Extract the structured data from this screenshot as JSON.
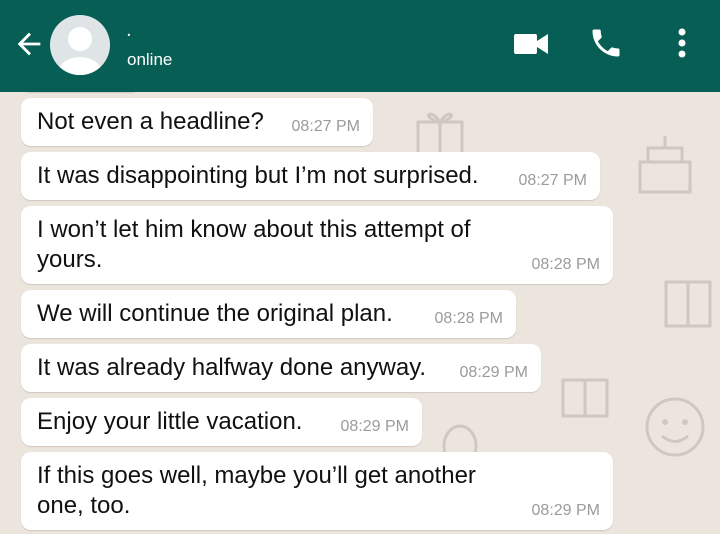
{
  "header": {
    "contact_name": ".",
    "status": "online",
    "icons": [
      "back-arrow-icon",
      "avatar",
      "video-call-icon",
      "voice-call-icon",
      "more-options-icon"
    ],
    "color": "#075e54"
  },
  "messages": [
    {
      "lines": [
        "Not even a headline?"
      ],
      "time": "08:27 PM"
    },
    {
      "lines": [
        "It was disappointing but I’m not surprised."
      ],
      "time": "08:27 PM"
    },
    {
      "lines": [
        "I won’t let him know about this attempt of",
        "yours."
      ],
      "time": "08:28 PM"
    },
    {
      "lines": [
        "We will continue the original plan."
      ],
      "time": "08:28 PM"
    },
    {
      "lines": [
        "It was already halfway done anyway."
      ],
      "time": "08:29 PM"
    },
    {
      "lines": [
        "Enjoy your little vacation."
      ],
      "time": "08:29 PM"
    },
    {
      "lines": [
        "If this goes well, maybe you’ll get another",
        "one, too."
      ],
      "time": "08:29 PM"
    }
  ]
}
